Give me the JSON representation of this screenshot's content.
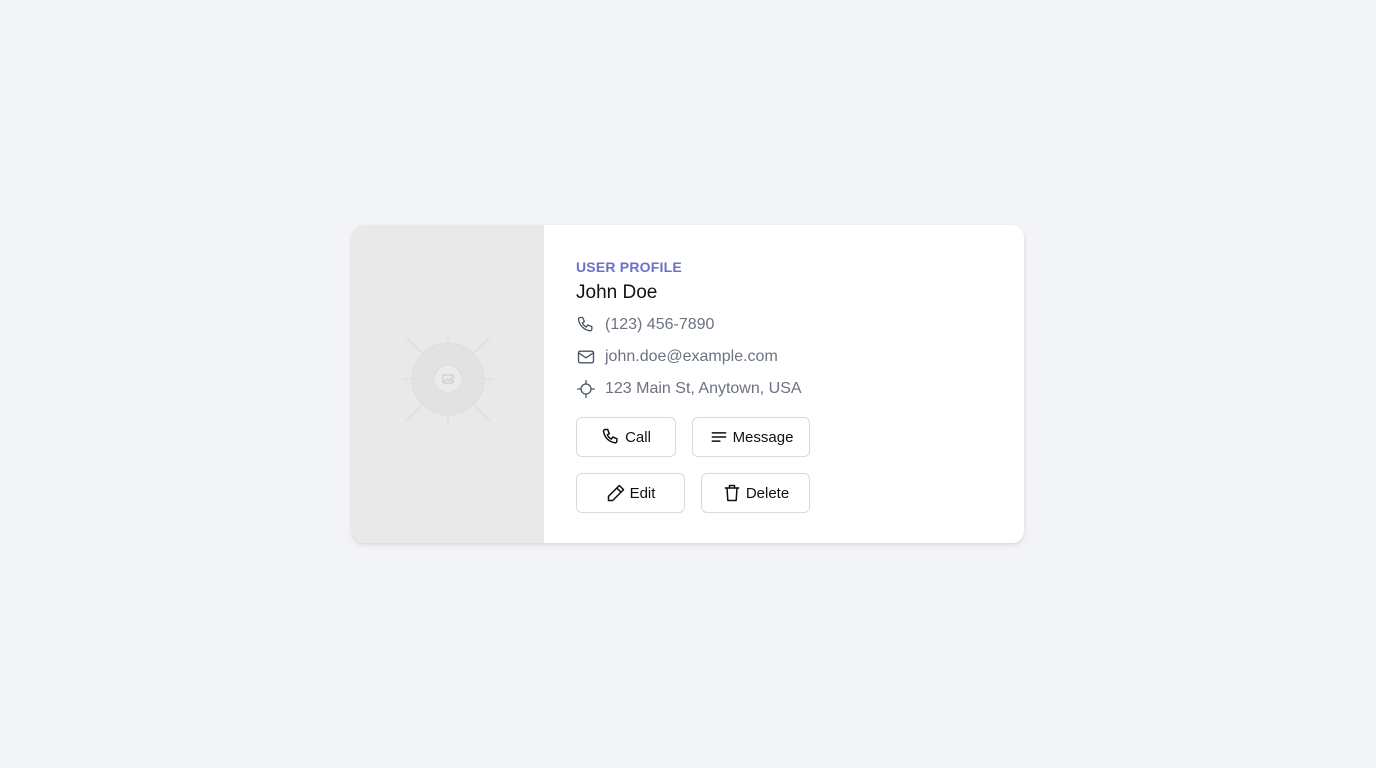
{
  "profile": {
    "eyebrow": "USER PROFILE",
    "name": "John Doe",
    "phone": "(123) 456-7890",
    "email": "john.doe@example.com",
    "address": "123 Main St, Anytown, USA"
  },
  "actions": {
    "call_label": "Call",
    "message_label": "Message",
    "edit_label": "Edit",
    "delete_label": "Delete"
  },
  "icons": {
    "image_placeholder": "image-placeholder-icon",
    "phone": "phone-icon",
    "email": "mail-icon",
    "address": "location-crosshair-icon",
    "call": "phone-icon",
    "message": "lines-icon",
    "edit": "pencil-icon",
    "delete": "trash-icon"
  },
  "colors": {
    "accent": "#6c70c9",
    "background": "#f3f4f6",
    "card": "#ffffff",
    "image_pane": "#e9e9e9",
    "muted_text": "#6b7280"
  }
}
